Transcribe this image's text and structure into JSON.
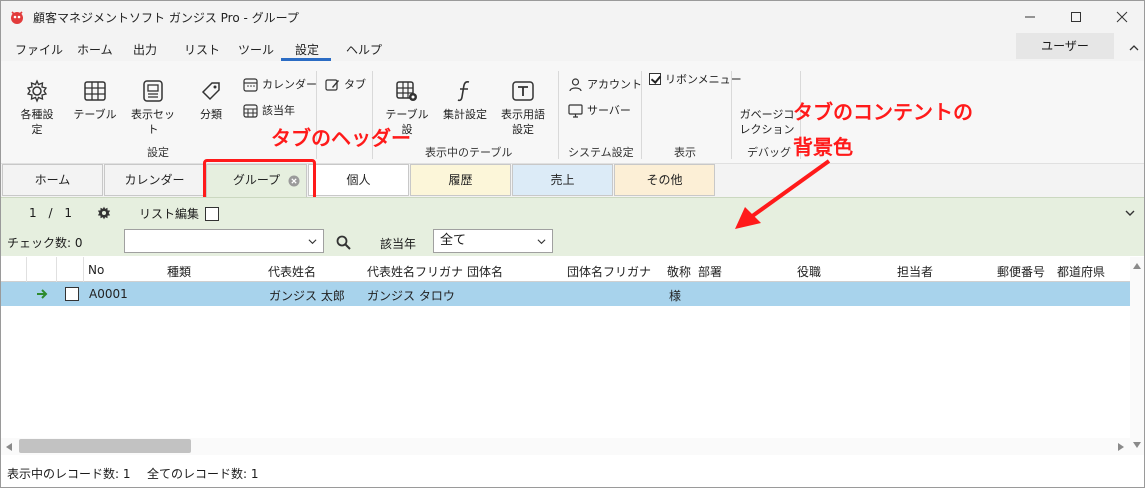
{
  "window": {
    "title": "顧客マネジメントソフト ガンジス Pro - グループ"
  },
  "menu": {
    "items": [
      "ファイル",
      "ホーム",
      "出力",
      "リスト",
      "ツール",
      "設定",
      "ヘルプ"
    ],
    "active": "設定",
    "user_button": "ユーザー"
  },
  "ribbon": {
    "settings_group": {
      "label": "設定",
      "various": "各種設\n定",
      "table": "テーブル",
      "display_set": "表示セッ\nト",
      "category": "分類",
      "calendar": "カレンダー",
      "current_year": "該当年"
    },
    "tab_item": "タブ",
    "display_table_group": {
      "label": "表示中のテーブル",
      "table_setting": "テーブル設",
      "aggregate": "集計設定",
      "display_terms": "表示用語\n設定"
    },
    "system_group": {
      "label": "システム設定",
      "account": "アカウント",
      "server": "サーバー"
    },
    "display_group": {
      "label": "表示",
      "ribbon_menu": "リボンメニュー"
    },
    "debug_group": {
      "label": "デバッグ",
      "gc": "ガベージコ\nレクション"
    }
  },
  "annotations": {
    "tab_header": "タブのヘッダー",
    "tab_content_bg_line1": "タブのコンテントの",
    "tab_content_bg_line2": "背景色"
  },
  "content_tabs": [
    {
      "label": "ホーム",
      "color": "#f3f3f3"
    },
    {
      "label": "カレンダー",
      "color": "#f3f3f3"
    },
    {
      "label": "グループ",
      "color": "#e6efdf"
    },
    {
      "label": "個人",
      "color": "#ffffff"
    },
    {
      "label": "履歴",
      "color": "#fcf6d9"
    },
    {
      "label": "売上",
      "color": "#dcebf7"
    },
    {
      "label": "その他",
      "color": "#fcefd6"
    }
  ],
  "toolbar": {
    "page_current": "1",
    "page_sep": "/",
    "page_total": "1",
    "list_edit": "リスト編集",
    "check_count": "チェック数:  0",
    "search_value": "",
    "year_label": "該当年",
    "year_value": "全て"
  },
  "grid": {
    "columns": [
      "No",
      "種類",
      "代表姓名",
      "代表姓名フリガナ",
      "団体名",
      "団体名フリガナ",
      "敬称",
      "部署",
      "役職",
      "担当者",
      "郵便番号",
      "都道府県"
    ],
    "rows": [
      {
        "No": "A0001",
        "種類": "",
        "代表姓名": "ガンジス 太郎",
        "代表姓名フリガナ": "ガンジス タロウ",
        "団体名": "",
        "団体名フリガナ": "",
        "敬称": "様"
      }
    ]
  },
  "status": {
    "shown_records": "表示中のレコード数:  1",
    "all_records": "全てのレコード数:  1"
  },
  "colors": {
    "accent": "#2b6cc4",
    "annotation": "#ff1a1a",
    "content_bg": "#e6efdf",
    "selected_row": "#a8d3ec"
  }
}
